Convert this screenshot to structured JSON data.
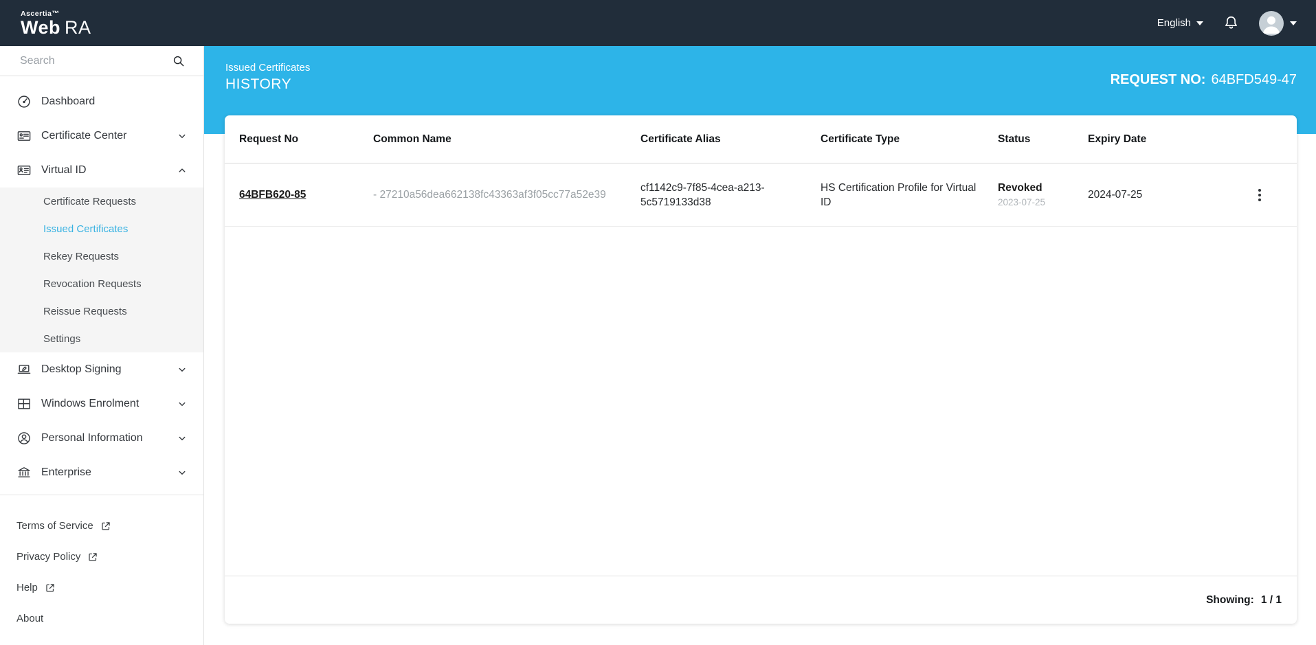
{
  "navbar": {
    "brand_small": "Ascertia™",
    "brand_web": "Web",
    "brand_ra": "RA",
    "language_label": "English"
  },
  "sidebar": {
    "search": {
      "placeholder": "Search"
    },
    "items": [
      {
        "label": "Dashboard"
      },
      {
        "label": "Certificate Center"
      },
      {
        "label": "Virtual ID"
      },
      {
        "label": "Desktop Signing"
      },
      {
        "label": "Windows Enrolment"
      },
      {
        "label": "Personal Information"
      },
      {
        "label": "Enterprise"
      }
    ],
    "virtual_id_submenu": [
      {
        "label": "Certificate Requests",
        "active": false
      },
      {
        "label": "Issued Certificates",
        "active": true
      },
      {
        "label": "Rekey Requests",
        "active": false
      },
      {
        "label": "Revocation Requests",
        "active": false
      },
      {
        "label": "Reissue Requests",
        "active": false
      },
      {
        "label": "Settings",
        "active": false
      }
    ],
    "footer_links": [
      {
        "label": "Terms of Service",
        "external": true
      },
      {
        "label": "Privacy Policy",
        "external": true
      },
      {
        "label": "Help",
        "external": true
      },
      {
        "label": "About",
        "external": false
      }
    ]
  },
  "page_header": {
    "breadcrumb": "Issued Certificates",
    "title": "HISTORY",
    "request_label": "REQUEST NO:",
    "request_value": "64BFD549-47"
  },
  "table": {
    "columns": [
      "Request No",
      "Common Name",
      "Certificate Alias",
      "Certificate Type",
      "Status",
      "Expiry Date"
    ],
    "rows": [
      {
        "request_no": "64BFB620-85",
        "common_name": "- 27210a56dea662138fc43363af3f05cc77a52e39",
        "certificate_alias": "cf1142c9-7f85-4cea-a213-5c5719133d38",
        "certificate_type": "HS Certification Profile for Virtual ID",
        "status": "Revoked",
        "status_date": "2023-07-25",
        "expiry_date": "2024-07-25"
      }
    ]
  },
  "panel_footer": {
    "showing_label": "Showing:",
    "showing_value": "1 / 1"
  },
  "icons": [
    "search-icon",
    "bell-icon",
    "avatar",
    "caret-down-icon",
    "dashboard-icon",
    "certificate-center-icon",
    "virtual-id-icon",
    "desktop-signing-icon",
    "windows-enrolment-icon",
    "personal-information-icon",
    "enterprise-icon",
    "chevron-down-icon",
    "chevron-up-icon",
    "external-link-icon",
    "kebab-menu-icon"
  ],
  "colors": {
    "navbar_bg": "#212d3a",
    "accent_blue": "#2db4e8",
    "active_link": "#38b2e2"
  }
}
